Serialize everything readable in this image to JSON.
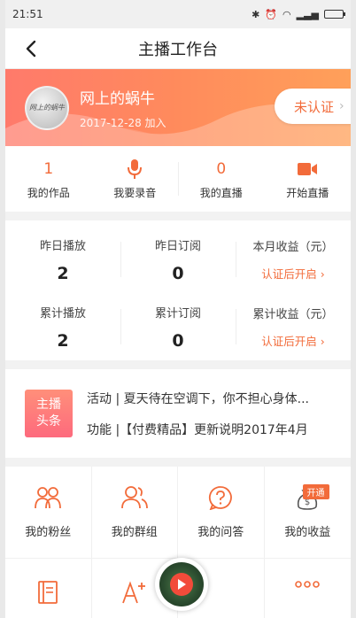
{
  "status_bar": {
    "time": "21:51"
  },
  "nav": {
    "title": "主播工作台"
  },
  "profile": {
    "name": "网上的蜗牛",
    "join_date": "2017-12-28 加入",
    "avatar_text": "网上的蜗牛",
    "verify_label": "未认证"
  },
  "quick_actions": [
    {
      "count": "1",
      "label": "我的作品"
    },
    {
      "icon": "microphone-icon",
      "label": "我要录音"
    },
    {
      "count": "0",
      "label": "我的直播"
    },
    {
      "icon": "video-camera-icon",
      "label": "开始直播"
    }
  ],
  "stats": {
    "rows": [
      [
        {
          "label": "昨日播放",
          "value": "2"
        },
        {
          "label": "昨日订阅",
          "value": "0"
        },
        {
          "label": "本月收益（元）",
          "link": "认证后开启"
        }
      ],
      [
        {
          "label": "累计播放",
          "value": "2"
        },
        {
          "label": "累计订阅",
          "value": "0"
        },
        {
          "label": "累计收益（元）",
          "link": "认证后开启"
        }
      ]
    ]
  },
  "headlines": {
    "logo_line1": "主播",
    "logo_line2": "头条",
    "items": [
      "活动 | 夏天待在空调下，你不担心身体...",
      "功能 |【付费精品】更新说明2017年4月"
    ]
  },
  "grid": [
    {
      "icon": "fans-icon",
      "label": "我的粉丝"
    },
    {
      "icon": "group-icon",
      "label": "我的群组"
    },
    {
      "icon": "question-icon",
      "label": "我的问答"
    },
    {
      "icon": "money-bag-icon",
      "label": "我的收益",
      "badge": "开通"
    },
    {
      "icon": "notebook-icon"
    },
    {
      "icon": "font-plus-icon"
    },
    {
      "icon": "player-icon"
    },
    {
      "icon": "more-icon"
    }
  ],
  "colors": {
    "accent": "#f26b3a",
    "banner_start": "#ff7a6b",
    "banner_end": "#ffa05a"
  }
}
